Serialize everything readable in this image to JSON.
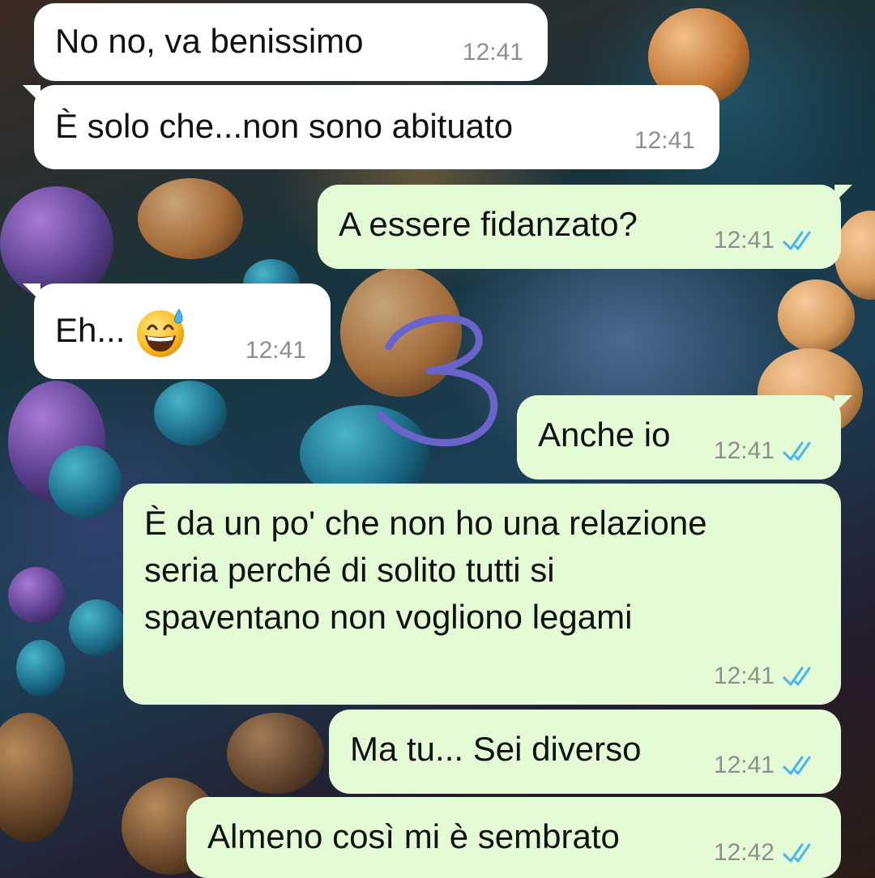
{
  "chat": {
    "messages": [
      {
        "text": "No no, va benissimo",
        "time": "12:41",
        "direction": "incoming"
      },
      {
        "text": "È solo che...non sono abituato",
        "time": "12:41",
        "direction": "incoming"
      },
      {
        "text": "A essere fidanzato?",
        "time": "12:41",
        "direction": "outgoing",
        "status": "read"
      },
      {
        "text": "Eh...",
        "emoji": "grinning-face-with-sweat",
        "time": "12:41",
        "direction": "incoming"
      },
      {
        "text": "Anche io",
        "time": "12:41",
        "direction": "outgoing",
        "status": "read"
      },
      {
        "text": "È da un po' che non ho una relazione\nseria perché di solito tutti si\nspaventano non vogliono legami",
        "time": "12:41",
        "direction": "outgoing",
        "status": "read"
      },
      {
        "text": "Ma tu... Sei diverso",
        "time": "12:41",
        "direction": "outgoing",
        "status": "read"
      },
      {
        "text": "Almeno così mi è sembrato",
        "time": "12:42",
        "direction": "outgoing",
        "status": "read"
      }
    ]
  },
  "annotation": {
    "handwritten_mark": "3",
    "color": "#6a63c9"
  },
  "colors": {
    "incoming_bubble": "#ffffff",
    "outgoing_bubble": "#e4fcd5",
    "read_tick": "#4fb6ec",
    "timestamp": "#8e8e8e"
  },
  "icons": {
    "read_receipt": "double-check-icon",
    "emoji": "grinning-face-with-sweat-icon"
  }
}
